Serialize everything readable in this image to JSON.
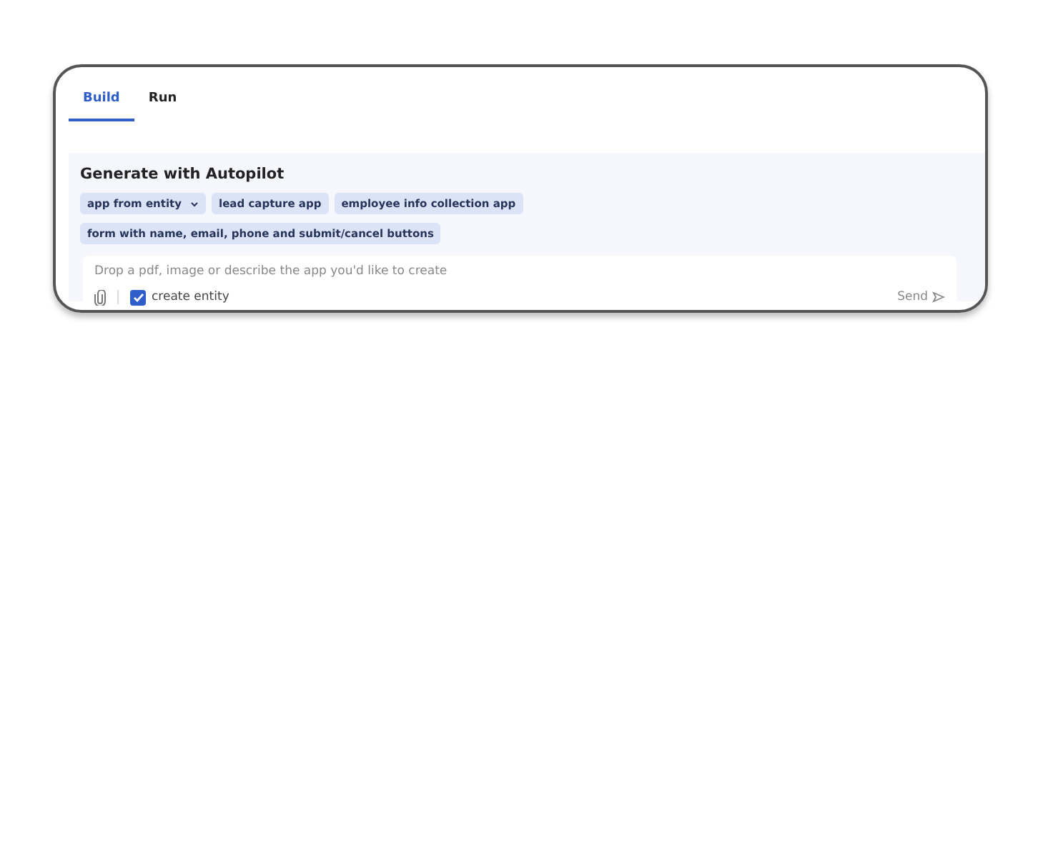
{
  "tabs": [
    {
      "label": "Build",
      "selected": true
    },
    {
      "label": "Run",
      "selected": false
    }
  ],
  "autopilot": {
    "title": "Generate with Autopilot",
    "suggestions": [
      {
        "label": "app from entity",
        "kind": "dropdown"
      },
      {
        "label": "lead capture app",
        "kind": "chip"
      },
      {
        "label": "employee info collection app",
        "kind": "chip"
      },
      {
        "label": "form with name, email, phone and submit/cancel buttons",
        "kind": "chip"
      }
    ],
    "prompt": {
      "placeholder": "Drop a pdf, image or describe the app you'd like to create"
    },
    "create_entity": {
      "label": "create entity",
      "checked": true
    },
    "send": "Send"
  }
}
